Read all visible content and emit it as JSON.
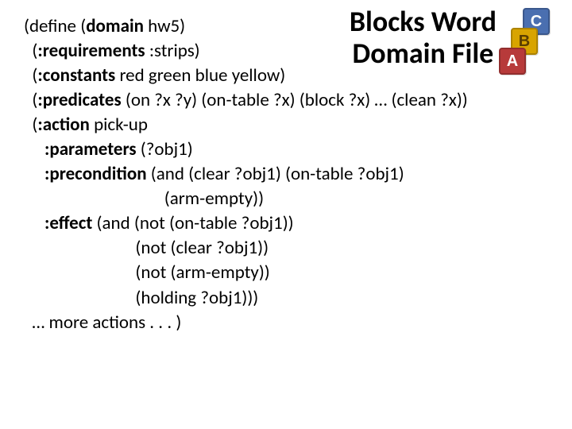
{
  "title_line1": "Blocks Word",
  "title_line2": "Domain File",
  "icon": {
    "c": "C",
    "b": "B",
    "a": "A"
  },
  "code": {
    "l1a": "(define (",
    "l1b": "domain",
    "l1c": " hw5)",
    "l2a": "  (",
    "l2b": ":requirements",
    "l2c": " :strips)",
    "l3a": "  (",
    "l3b": ":constants",
    "l3c": " red green blue yellow)",
    "l4a": "  (",
    "l4b": ":predicates",
    "l4c": " (on ?x ?y) (on-table ?x) (block ?x) … (clean ?x))",
    "l5a": "  (",
    "l5b": ":action",
    "l5c": " pick-up",
    "l6a": "     ",
    "l6b": ":parameters",
    "l6c": " (?obj1)",
    "l7a": "     ",
    "l7b": ":precondition",
    "l7c": " (and (clear ?obj1) (on-table ?obj1)",
    "l8": "                                  (arm-empty))",
    "l9a": "     ",
    "l9b": ":effect",
    "l9c": " (and (not (on-table ?obj1))",
    "l10": "                           (not (clear ?obj1))",
    "l11": "                           (not (arm-empty))",
    "l12": "                           (holding ?obj1)))",
    "l13": "  … more actions . . . )"
  }
}
